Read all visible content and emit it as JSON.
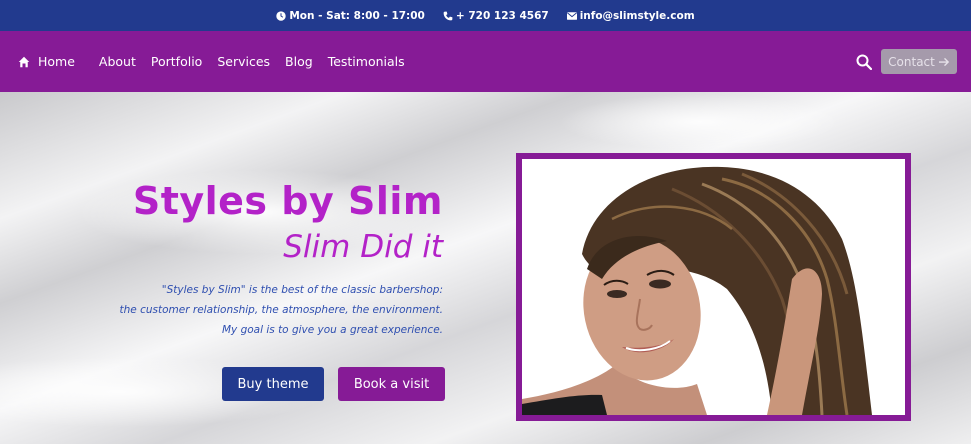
{
  "topbar": {
    "hours": "Mon - Sat: 8:00 - 17:00",
    "phone": "+ 720 123 4567",
    "email": "info@slimstyle.com"
  },
  "nav": {
    "home": "Home",
    "items": [
      "About",
      "Portfolio",
      "Services",
      "Blog",
      "Testimonials"
    ],
    "contact": "Contact"
  },
  "hero": {
    "title": "Styles by Slim",
    "subtitle": "Slim Did it",
    "desc_lines": [
      "\"Styles by Slim\" is the best of the classic barbershop:",
      "the customer relationship, the atmosphere, the environment.",
      "My goal is to give you a great experience."
    ],
    "buy_label": "Buy theme",
    "book_label": "Book a visit"
  },
  "colors": {
    "topbar": "#223a8e",
    "navbar": "#861b96",
    "accent_text": "#b322c8",
    "desc_text": "#2f4fb0"
  },
  "icons": {
    "clock": "clock-icon",
    "phone": "phone-icon",
    "mail": "mail-icon",
    "home": "home-icon",
    "search": "search-icon",
    "arrow": "arrow-right-icon"
  }
}
